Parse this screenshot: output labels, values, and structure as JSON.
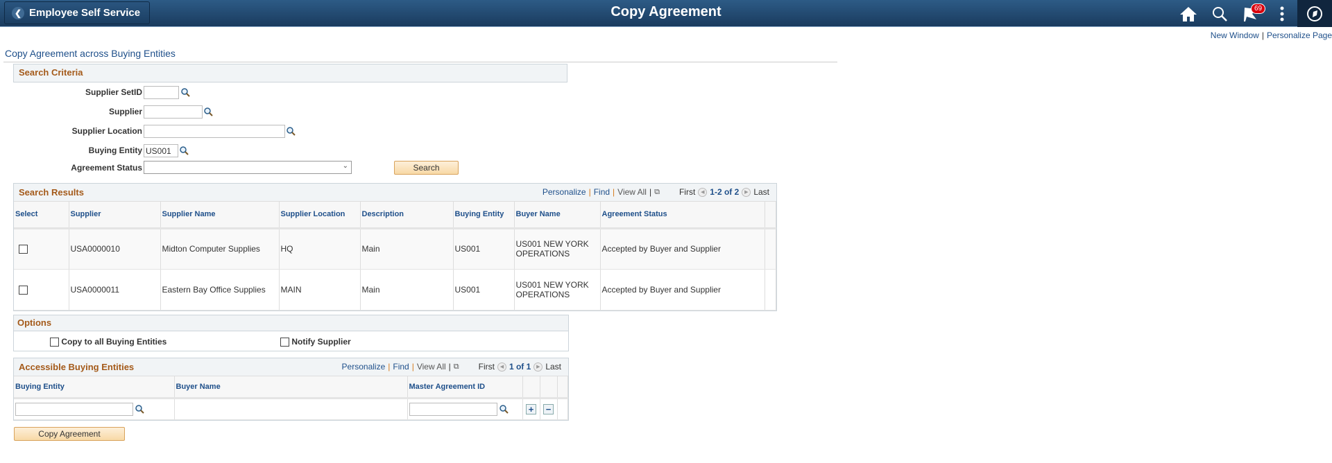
{
  "header": {
    "back_label": "Employee Self Service",
    "title": "Copy Agreement",
    "notification_count": "69",
    "icons": [
      "home-icon",
      "search-icon",
      "flag-icon",
      "more-icon",
      "navbar-icon"
    ]
  },
  "top_links": {
    "new_window": "New Window",
    "separator": "|",
    "personalize_page": "Personalize Page"
  },
  "page_title": "Copy Agreement across Buying Entities",
  "search_criteria": {
    "title": "Search Criteria",
    "fields": {
      "supplier_setid": {
        "label": "Supplier SetID",
        "value": ""
      },
      "supplier": {
        "label": "Supplier",
        "value": ""
      },
      "supplier_location": {
        "label": "Supplier Location",
        "value": ""
      },
      "buying_entity": {
        "label": "Buying Entity",
        "value": "US001"
      },
      "agreement_status": {
        "label": "Agreement Status",
        "value": ""
      }
    },
    "search_button": "Search"
  },
  "grid_nav": {
    "personalize": "Personalize",
    "find": "Find",
    "view_all": "View All",
    "first": "First",
    "last": "Last",
    "pipe": "|"
  },
  "search_results": {
    "title": "Search Results",
    "range": "1-2 of 2",
    "columns": [
      "Select",
      "Supplier",
      "Supplier Name",
      "Supplier Location",
      "Description",
      "Buying Entity",
      "Buyer Name",
      "Agreement Status"
    ],
    "rows": [
      {
        "selected": false,
        "supplier": "USA0000010",
        "supplier_name": "Midton Computer Supplies",
        "location": "HQ",
        "description": "Main",
        "buying_entity": "US001",
        "buyer_name": "US001 NEW YORK OPERATIONS",
        "status": "Accepted by Buyer and Supplier"
      },
      {
        "selected": false,
        "supplier": "USA0000011",
        "supplier_name": "Eastern Bay Office Supplies",
        "location": "MAIN",
        "description": "Main",
        "buying_entity": "US001",
        "buyer_name": "US001 NEW YORK OPERATIONS",
        "status": "Accepted by Buyer and Supplier"
      }
    ]
  },
  "options": {
    "title": "Options",
    "copy_to_all": {
      "label": "Copy to all Buying Entities",
      "checked": false
    },
    "notify_supplier": {
      "label": "Notify Supplier",
      "checked": false
    }
  },
  "accessible_entities": {
    "title": "Accessible Buying Entities",
    "range": "1 of 1",
    "columns": [
      "Buying Entity",
      "Buyer Name",
      "Master Agreement ID"
    ],
    "rows": [
      {
        "buying_entity": "",
        "buyer_name": "",
        "master_agreement_id": ""
      }
    ]
  },
  "copy_button": "Copy Agreement"
}
